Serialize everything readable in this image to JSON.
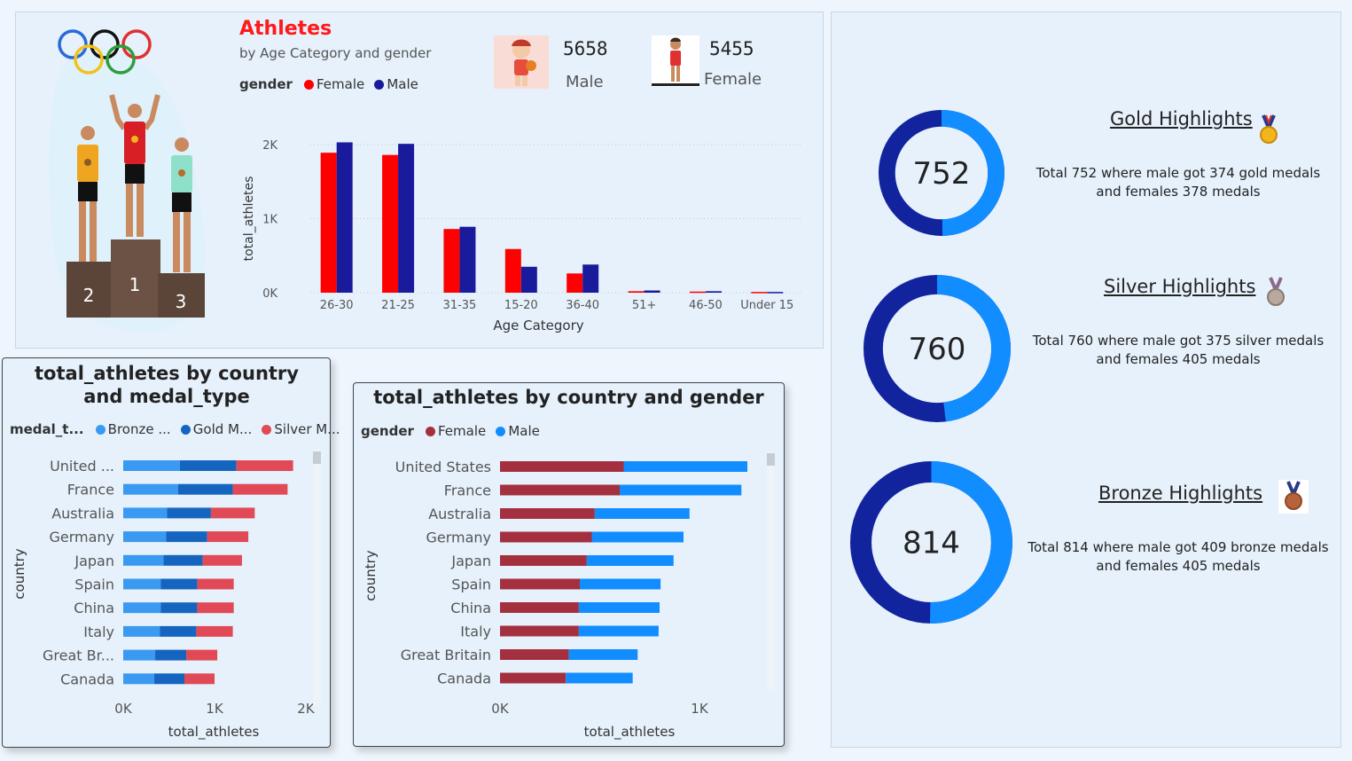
{
  "header": {
    "title": "Athletes",
    "subtitle": "by Age Category and gender",
    "legend_key": "gender",
    "legend": [
      {
        "name": "Female",
        "color": "#ff0000"
      },
      {
        "name": "Male",
        "color": "#1a1a9c"
      }
    ]
  },
  "kpis": {
    "male_count": "5658",
    "male_label": "Male",
    "female_count": "5455",
    "female_label": "Female"
  },
  "podium": {
    "first": "1",
    "second": "2",
    "third": "3"
  },
  "highlights": [
    {
      "title": "Gold Highlights",
      "total": "752",
      "description": "Total 752 where male got 374 gold medals and females 378 medals",
      "male": 374,
      "female": 378,
      "icon": "gold-medal-icon"
    },
    {
      "title": "Silver Highlights",
      "total": "760",
      "description": "Total 760 where male got 375 silver medals and females 405 medals",
      "male": 375,
      "female": 405,
      "icon": "silver-medal-icon"
    },
    {
      "title": "Bronze Highlights",
      "total": "814",
      "description": "Total 814 where male got 409 bronze medals and females 405 medals",
      "male": 409,
      "female": 405,
      "icon": "bronze-medal-icon"
    }
  ],
  "ring_colors": {
    "light": "#118dff",
    "dark": "#12239e"
  },
  "medal_chart": {
    "title": "total_athletes by country and medal_type",
    "legend_key": "medal_t...",
    "legend_labels": [
      "Bronze ...",
      "Gold M...",
      "Silver M..."
    ]
  },
  "gender_chart": {
    "title": "total_athletes by country and gender",
    "legend_key": "gender",
    "legend_labels": [
      "Female",
      "Male"
    ]
  },
  "chart_data": [
    {
      "type": "bar",
      "xlabel": "Age Category",
      "ylabel": "total_athletes",
      "categories": [
        "26-30",
        "21-25",
        "31-35",
        "15-20",
        "36-40",
        "51+",
        "46-50",
        "Under 15"
      ],
      "series": [
        {
          "name": "Female",
          "color": "#ff0000",
          "values": [
            1890,
            1860,
            860,
            590,
            260,
            20,
            15,
            10
          ]
        },
        {
          "name": "Male",
          "color": "#1a1a9c",
          "values": [
            2030,
            2010,
            890,
            350,
            380,
            30,
            20,
            10
          ]
        }
      ],
      "ylim": [
        0,
        2000
      ],
      "yticks": [
        0,
        1000,
        2000
      ],
      "ytick_labels": [
        "0K",
        "1K",
        "2K"
      ],
      "grid": true
    },
    {
      "type": "bar",
      "orientation": "horizontal",
      "stacked": true,
      "xlabel": "total_athletes",
      "ylabel": "country",
      "categories": [
        "United ...",
        "France",
        "Australia",
        "Germany",
        "Japan",
        "Spain",
        "China",
        "Italy",
        "Great Br...",
        "Canada"
      ],
      "series": [
        {
          "name": "Bronze ...",
          "color": "#3a99f0",
          "values": [
            620,
            600,
            480,
            470,
            440,
            410,
            410,
            400,
            350,
            340
          ]
        },
        {
          "name": "Gold M...",
          "color": "#1565c0",
          "values": [
            620,
            600,
            480,
            450,
            430,
            400,
            400,
            400,
            340,
            330
          ]
        },
        {
          "name": "Silver M...",
          "color": "#e04955",
          "values": [
            620,
            600,
            480,
            450,
            430,
            400,
            400,
            400,
            340,
            330
          ]
        }
      ],
      "xlim": [
        0,
        2000
      ],
      "xticks": [
        0,
        1000,
        2000
      ],
      "xtick_labels": [
        "0K",
        "1K",
        "2K"
      ]
    },
    {
      "type": "bar",
      "orientation": "horizontal",
      "stacked": true,
      "xlabel": "total_athletes",
      "ylabel": "country",
      "categories": [
        "United States",
        "France",
        "Australia",
        "Germany",
        "Japan",
        "Spain",
        "China",
        "Italy",
        "Great Britain",
        "Canada"
      ],
      "series": [
        {
          "name": "Female",
          "color": "#a4303f",
          "values": [
            620,
            600,
            475,
            460,
            435,
            400,
            395,
            395,
            345,
            330
          ]
        },
        {
          "name": "Male",
          "color": "#118dff",
          "values": [
            620,
            610,
            475,
            460,
            435,
            405,
            405,
            400,
            345,
            335
          ]
        }
      ],
      "xlim": [
        0,
        1600
      ],
      "xticks": [
        0,
        1000
      ],
      "xtick_labels": [
        "0K",
        "1K"
      ]
    }
  ]
}
